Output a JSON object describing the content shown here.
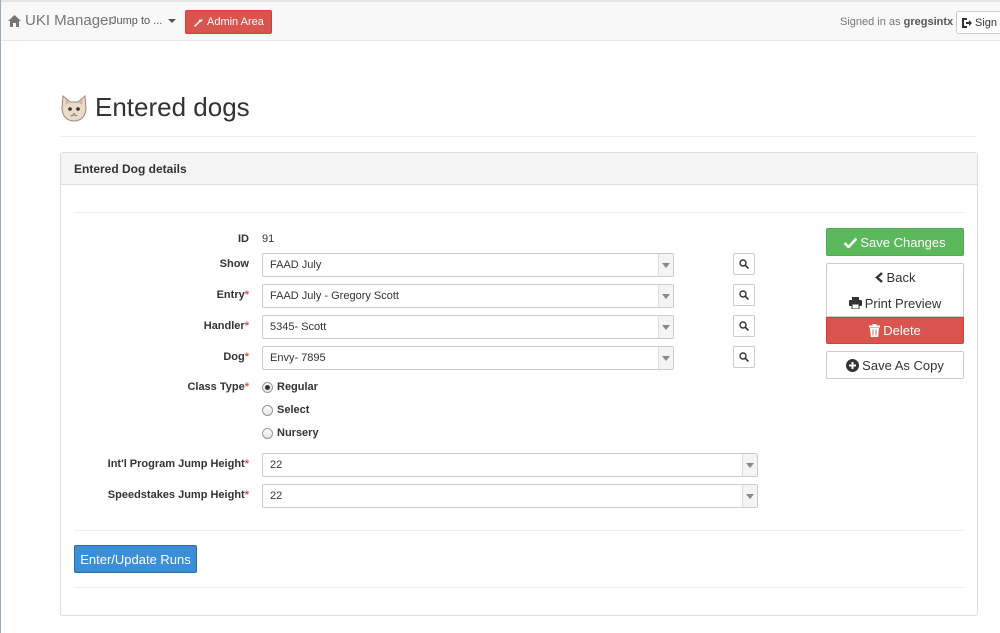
{
  "navbar": {
    "brand": "UKI Manager",
    "jump_label": "Jump to ...",
    "admin_label": "Admin Area",
    "signed_prefix": "Signed in as",
    "username": "gregsintx",
    "sign_label": "Sign"
  },
  "page": {
    "title": "Entered dogs"
  },
  "panel": {
    "heading": "Entered Dog details"
  },
  "form": {
    "id_label": "ID",
    "id_value": "91",
    "show_label": "Show",
    "show_value": "FAAD July",
    "entry_label": "Entry",
    "entry_value": "FAAD July - Gregory Scott",
    "handler_label": "Handler",
    "handler_value": "5345- Scott",
    "dog_label": "Dog",
    "dog_value": "Envy- 7895",
    "class_type_label": "Class Type",
    "class_options": [
      "Regular",
      "Select",
      "Nursery"
    ],
    "class_selected": "Regular",
    "intl_label": "Int'l Program Jump Height",
    "intl_value": "22",
    "speed_label": "Speedstakes Jump Height",
    "speed_value": "22",
    "required_mark": "*"
  },
  "actions": {
    "save": "Save Changes",
    "back": "Back",
    "print": "Print Preview",
    "delete": "Delete",
    "copy": "Save As Copy",
    "runs": "Enter/Update Runs"
  },
  "colors": {
    "success": "#5cb85c",
    "danger": "#d9534f",
    "primary": "#3a8fd6"
  }
}
